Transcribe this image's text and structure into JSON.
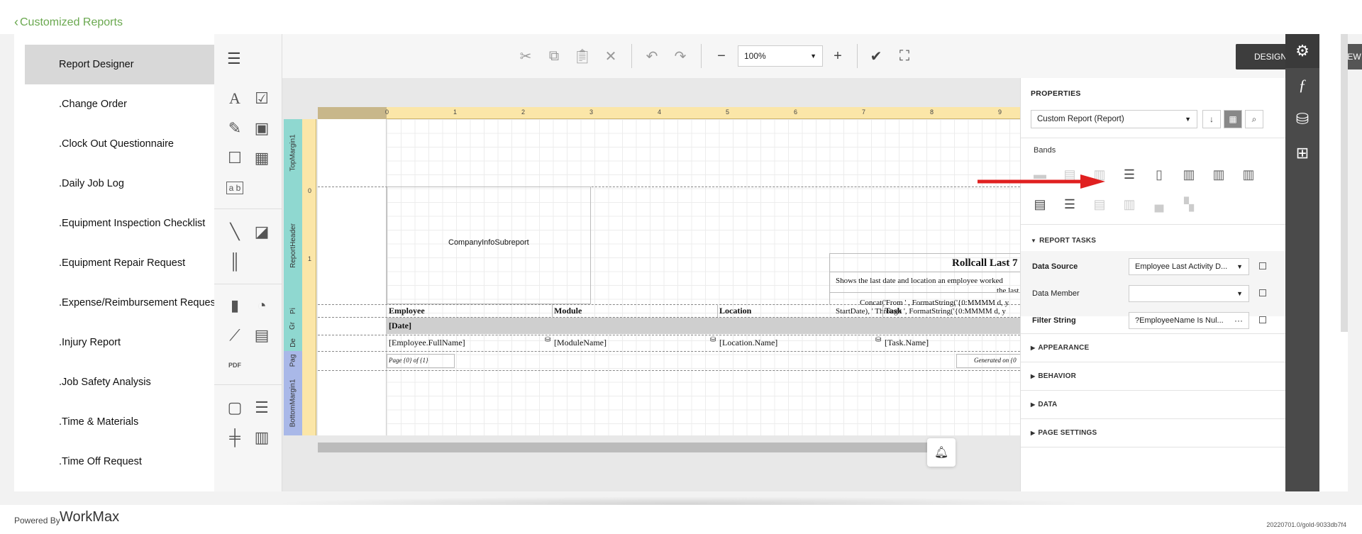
{
  "header": {
    "back_label": "Customized Reports"
  },
  "reports": {
    "items": [
      {
        "label": "Report Designer",
        "active": true
      },
      {
        "label": ".Change Order"
      },
      {
        "label": ".Clock Out Questionnaire"
      },
      {
        "label": ".Daily Job Log"
      },
      {
        "label": ".Equipment Inspection Checklist"
      },
      {
        "label": ".Equipment Repair Request"
      },
      {
        "label": ".Expense/Reimbursement Request"
      },
      {
        "label": ".Injury Report"
      },
      {
        "label": ".Job Safety Analysis"
      },
      {
        "label": ".Time & Materials"
      },
      {
        "label": ".Time Off Request"
      }
    ]
  },
  "toolbar": {
    "zoom_value": "100%",
    "design_label": "DESIGN",
    "preview_label": "PREVIEW"
  },
  "ruler": {
    "marks": [
      "0",
      "1",
      "2",
      "3",
      "4",
      "5",
      "6",
      "7",
      "8",
      "9"
    ],
    "vmarks": [
      "0",
      "1"
    ]
  },
  "bands": {
    "labels": [
      "TopMargin1",
      "ReportHeader",
      "Pi",
      "Gr",
      "De",
      "Pag",
      "BottomMargin1"
    ]
  },
  "canvas": {
    "company_subreport": "CompanyInfoSubreport",
    "title": "Rollcall Last 7",
    "subtitle_line1": "Shows the last date and location an employee worked",
    "subtitle_line2": "the last",
    "concat_line1": "Concat('From ' , FormatString('{0:MMMM d, y",
    "concat_line2": "StartDate), ' Through ', FormatString('{0:MMMM d, y",
    "columns": [
      "Employee",
      "Module",
      "Location",
      "Task"
    ],
    "group_field": "[Date]",
    "detail_fields": [
      "[Employee.FullName]",
      "[ModuleName]",
      "[Location.Name]",
      "[Task.Name]"
    ],
    "page_info": "Page {0} of {1}",
    "generated_on": "Generated on {0"
  },
  "properties": {
    "title": "PROPERTIES",
    "selected_object": "Custom Report (Report)",
    "bands_label": "Bands",
    "report_tasks": "REPORT TASKS",
    "rows": [
      {
        "label": "Data Source",
        "value": "Employee Last Activity D...",
        "bold": true
      },
      {
        "label": "Data Member",
        "value": "",
        "bold": false
      },
      {
        "label": "Filter String",
        "value": "?EmployeeName Is Nul...",
        "bold": true
      }
    ],
    "sections": [
      "APPEARANCE",
      "BEHAVIOR",
      "DATA",
      "PAGE SETTINGS"
    ]
  },
  "footer": {
    "powered_by": "Powered By",
    "logo_text": "WorkMax",
    "version": "20220701.0/gold-9033db7f4"
  },
  "colors": {
    "accent_green": "#6aa84f",
    "arrow_red": "#e02020",
    "ruler_yellow": "#fbe6a8",
    "band_teal": "#8fd8d0",
    "band_blue": "#a9b8e8"
  }
}
